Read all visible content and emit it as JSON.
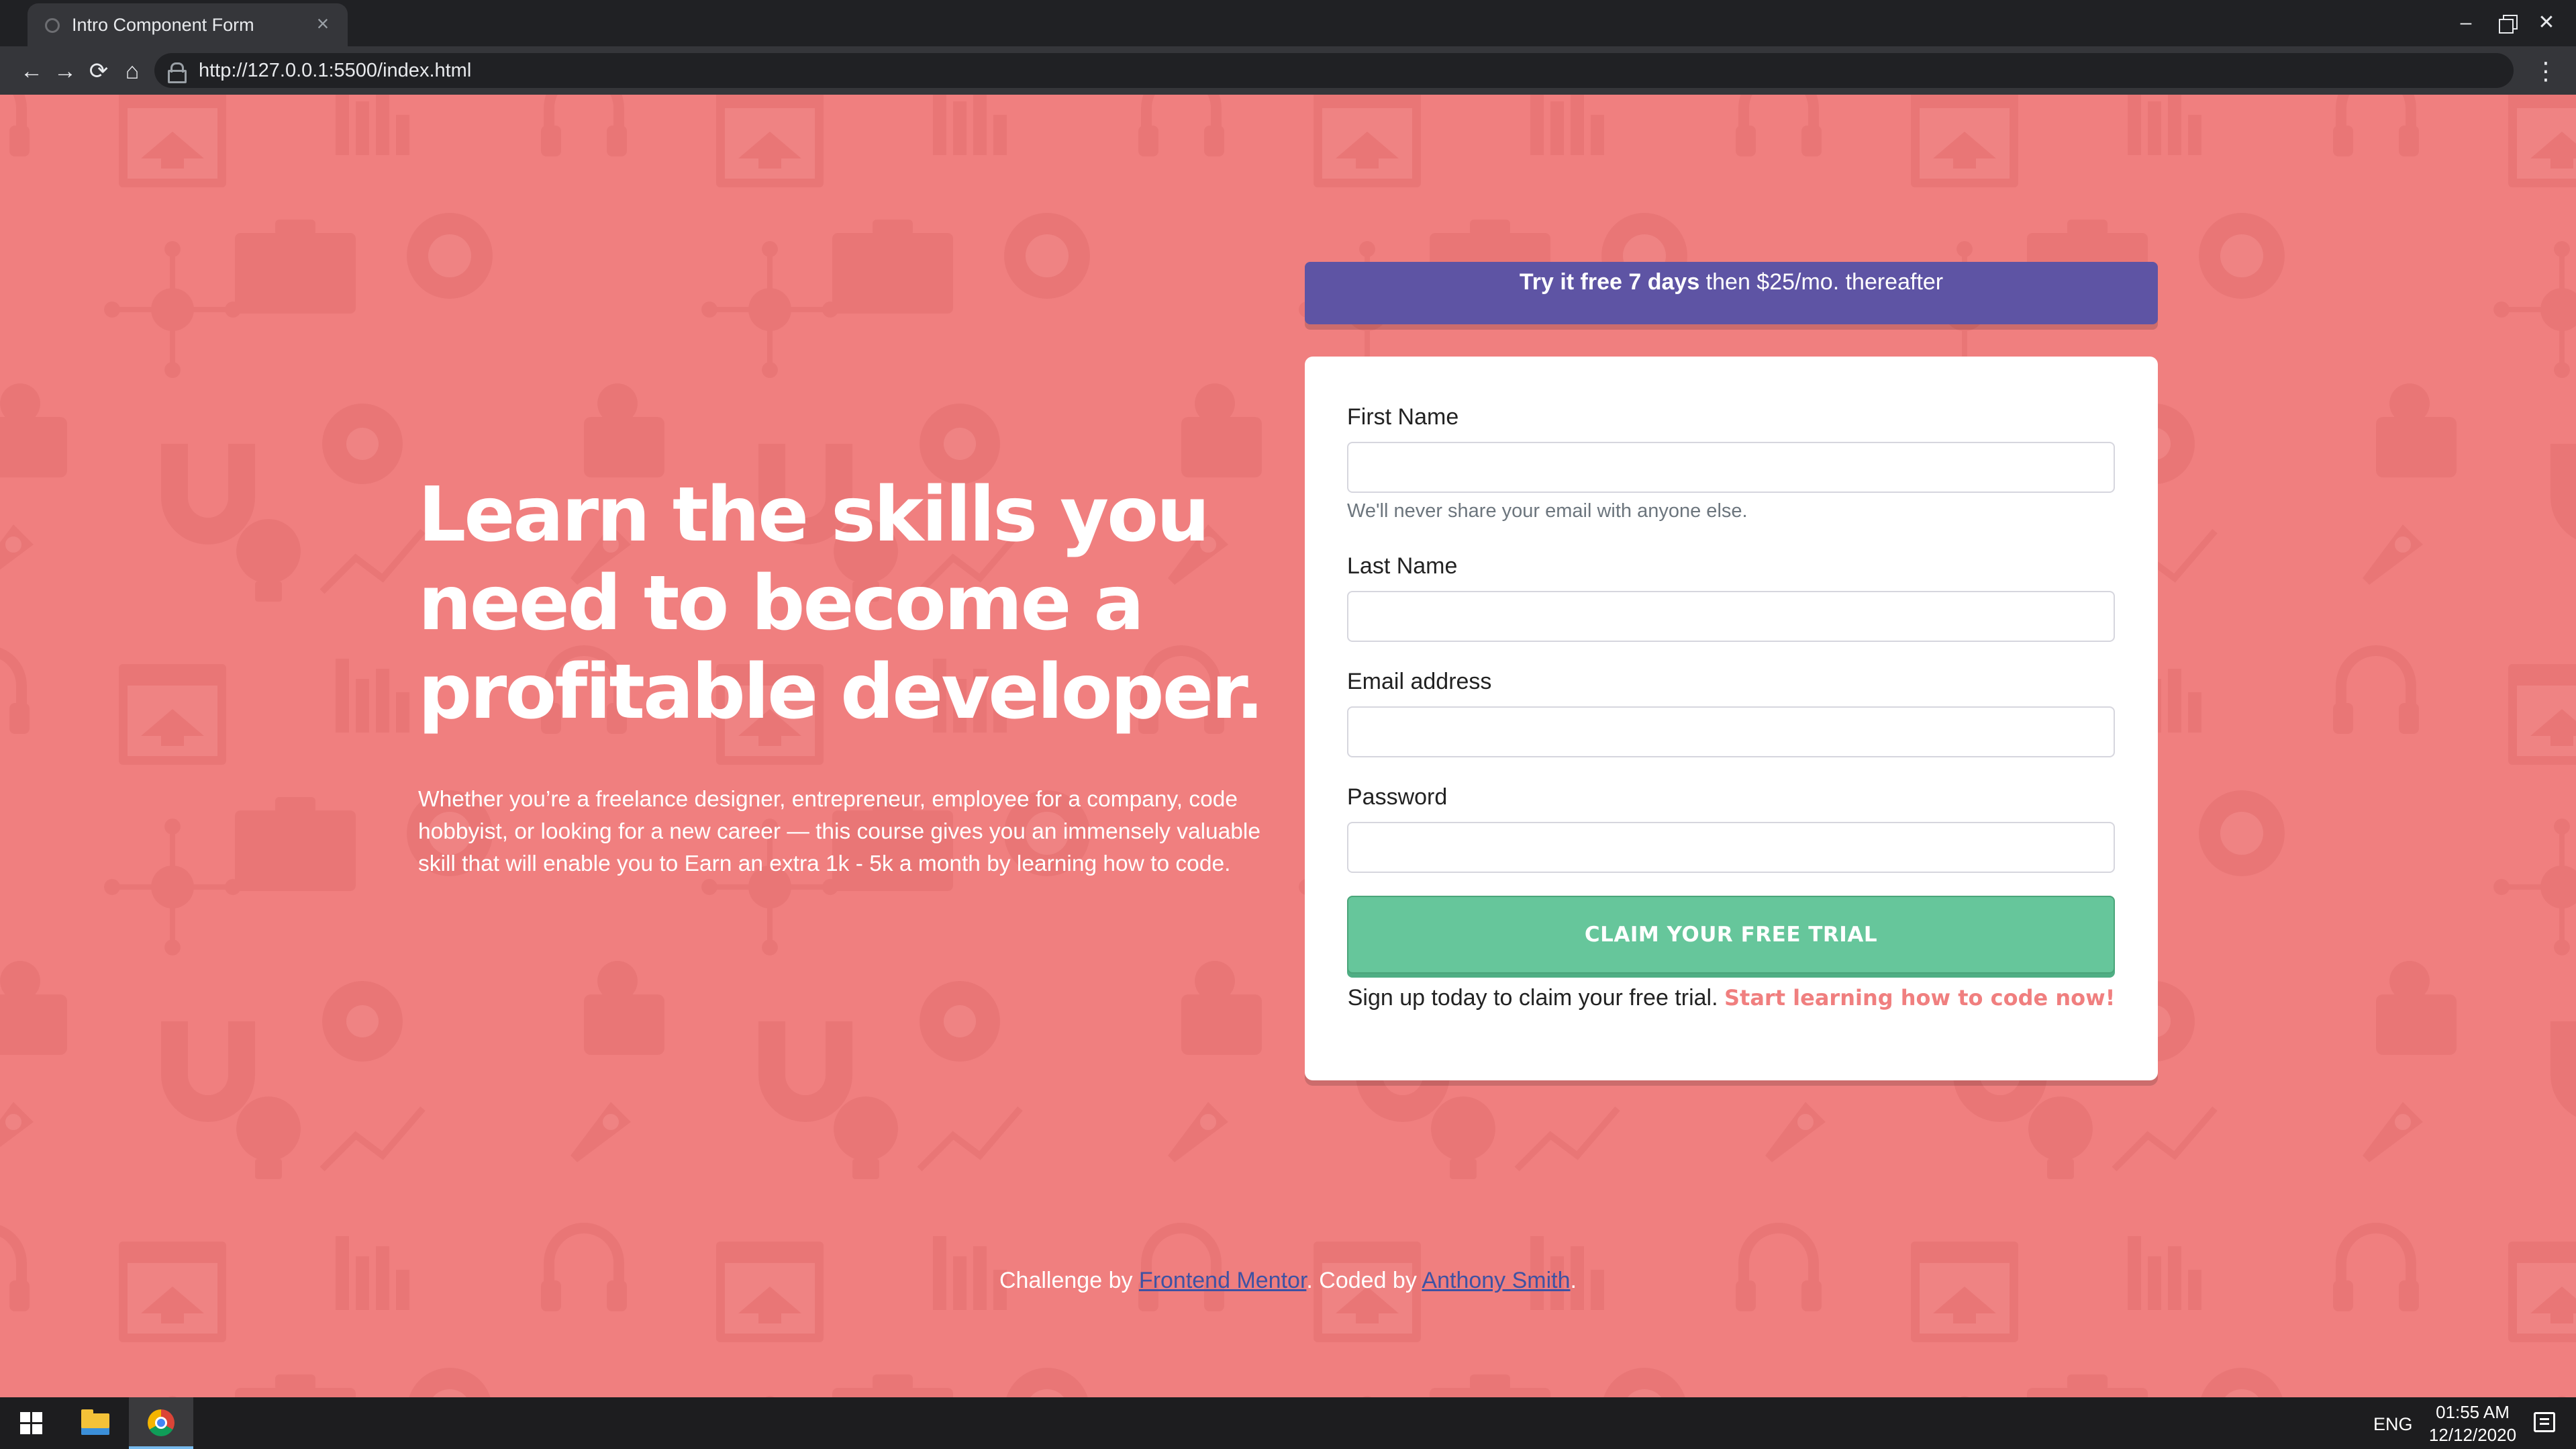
{
  "browser": {
    "tab_title": "Intro Component Form",
    "tab_close": "×",
    "url": "http://127.0.0.1:5500/index.html",
    "nav": {
      "back": "←",
      "forward": "→",
      "reload": "⟳",
      "home": "⌂",
      "menu": "⋮"
    },
    "window": {
      "minimize": "–",
      "close": "✕"
    }
  },
  "hero": {
    "title_lines": [
      "Learn the skills you",
      "need to become a",
      "profitable developer."
    ],
    "text": "Whether you’re a freelance designer, entrepreneur, employee for a company, code hobbyist, or looking for a new career — this course gives you an immensely valuable skill that will enable you to Earn an extra 1k - 5k a month by learning how to code."
  },
  "promo": {
    "bold": "Try it free 7 days",
    "rest": " then $25/mo. thereafter"
  },
  "form": {
    "first_name_label": "First Name",
    "first_name_value": "",
    "email_help": "We'll never share your email with anyone else.",
    "last_name_label": "Last Name",
    "last_name_value": "",
    "email_label": "Email address",
    "email_value": "",
    "password_label": "Password",
    "password_value": "",
    "submit_label": "CLAIM YOUR FREE TRIAL",
    "terms_text": "Sign up today to claim your free trial. ",
    "terms_link": "Start learning how to code now!"
  },
  "footer": {
    "prefix": "Challenge by ",
    "link1": "Frontend Mentor",
    "middle": ". Coded by ",
    "link2": "Anthony Smith",
    "suffix": "."
  },
  "taskbar": {
    "lang": "ENG",
    "time": "01:55 AM",
    "date": "12/12/2020",
    "icons": [
      "windows-start-icon",
      "file-explorer-icon",
      "chrome-icon",
      "notification-icon"
    ]
  },
  "colors": {
    "page_bg": "#f07f7f",
    "promo_bg": "#5e54a4",
    "button_bg": "#66c69b",
    "link": "#3e52a3",
    "accent_text": "#f07f7f"
  }
}
